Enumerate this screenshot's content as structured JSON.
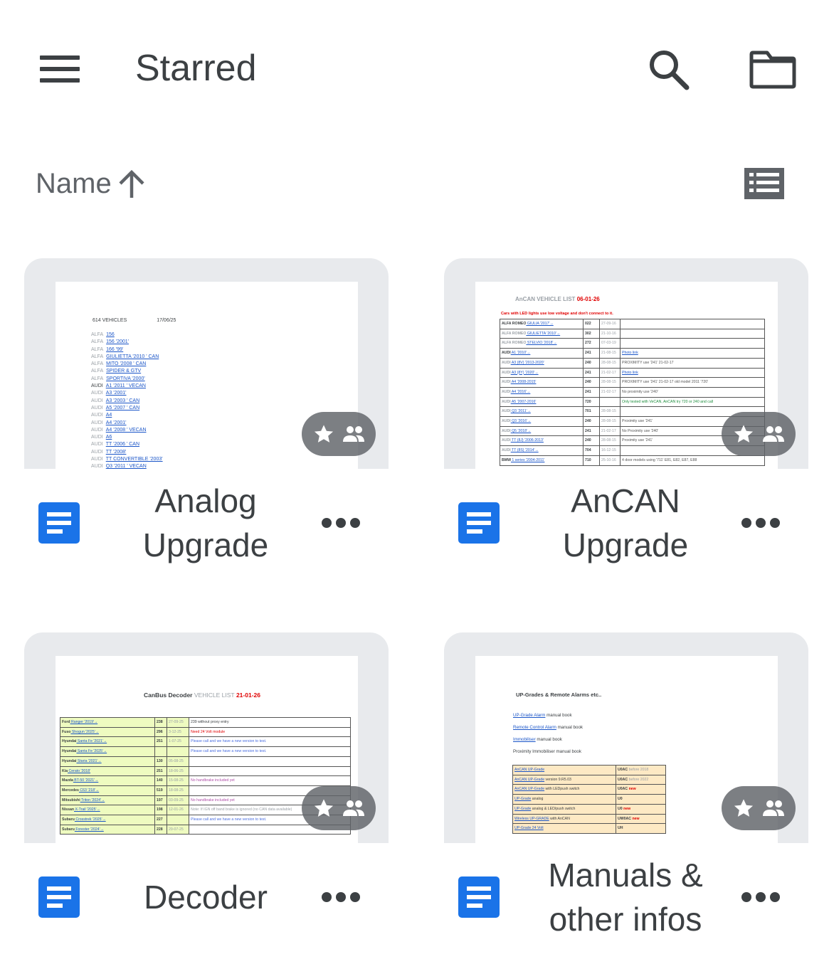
{
  "header": {
    "title": "Starred"
  },
  "sort": {
    "label": "Name",
    "arrow": "↑"
  },
  "files": [
    {
      "name": "Analog Upgrade",
      "preview": {
        "heading": "614 VEHICLES",
        "date": "17/06/25",
        "rows": [
          {
            "make": "ALFA",
            "model": "156"
          },
          {
            "make": "ALFA",
            "model": "156 '2001'"
          },
          {
            "make": "ALFA",
            "model": "166 '99'"
          },
          {
            "make": "ALFA",
            "model": "GIULIETTA '2010 ' CAN"
          },
          {
            "make": "ALFA",
            "model": "MITO '2008 ' CAN"
          },
          {
            "make": "ALFA",
            "model": "SPIDER & GTV"
          },
          {
            "make": "ALFA",
            "model": "SPORTIVA '2000'"
          },
          {
            "make": "AUDI",
            "model": "A1 '2011 ' VECAN"
          },
          {
            "make": "AUDI",
            "model": "A3 '2001'"
          },
          {
            "make": "AUDI",
            "model": "A3 '2003 ' CAN"
          },
          {
            "make": "AUDI",
            "model": "A5 '2007 ' CAN"
          },
          {
            "make": "AUDI",
            "model": "A4"
          },
          {
            "make": "AUDI",
            "model": "A4 '2001'"
          },
          {
            "make": "AUDI",
            "model": "A4 '2008 ' VECAN"
          },
          {
            "make": "AUDI",
            "model": "A6"
          },
          {
            "make": "AUDI",
            "model": "TT '2006 ' CAN"
          },
          {
            "make": "AUDI",
            "model": "TT '2008'"
          },
          {
            "make": "AUDI",
            "model": "TT CONVERTIBLE '2003'"
          },
          {
            "make": "AUDI",
            "model": "Q3 '2011 ' VECAN"
          }
        ]
      }
    },
    {
      "name": "AnCAN Upgrade",
      "preview": {
        "title": "AnCAN VEHICLE LIST",
        "date": "06-01-26",
        "warning": "Cars with LED lights use low voltage and don't connect to it.",
        "rows": [
          {
            "make": "ALFA ROMEO",
            "model": "GIULIA '2017'→",
            "code": "022",
            "date": "27-09-16",
            "note": ""
          },
          {
            "make": "ALFA ROMEO",
            "model": "GIULIETTA '2010'→",
            "code": "302",
            "date": "21-10-16",
            "note": ""
          },
          {
            "make": "ALFA ROMEO",
            "model": "STELVIO '2018'→",
            "code": "272",
            "date": "07-03-19",
            "note": ""
          },
          {
            "make": "AUDI",
            "model": "A1 '2010'→",
            "code": "241",
            "date": "21-08-15",
            "note": "Photo link"
          },
          {
            "make": "AUDI",
            "model": "A3 (8V) '2013-2020'",
            "code": "240",
            "date": "28-08-15",
            "note": "PROXIMITY use '241' 21-02-17"
          },
          {
            "make": "AUDI",
            "model": "A3 (8Y) '2020'→",
            "code": "241",
            "date": "21-02-17",
            "note": "Photo link"
          },
          {
            "make": "AUDI",
            "model": "A4 '2008-2015'",
            "code": "240",
            "date": "28-08-15",
            "note": "PROXIMITY use '241' 21-02-17 old model 2011 '720'"
          },
          {
            "make": "AUDI",
            "model": "A4 '2016'→",
            "code": "241",
            "date": "21-02-17",
            "note": "No proximity use '240'"
          },
          {
            "make": "AUDI",
            "model": "A5 '2007-2016'",
            "code": "720",
            "date": "",
            "note": "Only tested with VeCAN, AnCAN try 720 or 240 and call"
          },
          {
            "make": "AUDI",
            "model": "Q3 '2011'→",
            "code": "701",
            "date": "28-08-15",
            "note": ""
          },
          {
            "make": "AUDI",
            "model": "Q3 '2016'→",
            "code": "240",
            "date": "28-08-15",
            "note": "Proximity use '241'"
          },
          {
            "make": "AUDI",
            "model": "Q5 '2018'→",
            "code": "241",
            "date": "21-02-17",
            "note": "No Proximity use '240'"
          },
          {
            "make": "AUDI",
            "model": "TT (8J) '2006-2013'",
            "code": "240",
            "date": "28-08-15",
            "note": "Proximity use '241'"
          },
          {
            "make": "AUDI",
            "model": "TT (8S) '2014'→",
            "code": "704",
            "date": "16-12-15",
            "note": ""
          },
          {
            "make": "BMW",
            "model": "1 series '2004-2011'",
            "code": "710",
            "date": "25-10-16",
            "note": "4 door models using '711' E81, E82, E87, E88"
          }
        ]
      }
    },
    {
      "name": "Decoder",
      "preview": {
        "title_a": "CanBus Decoder",
        "title_b": "VEHICLE LIST",
        "date": "21-01-26",
        "rows": [
          {
            "make": "Ford",
            "model": "Ranger '2019'→",
            "code": "238",
            "date": "27-09-25",
            "note": "239 without proxy entry"
          },
          {
            "make": "Fuso",
            "model": "Shogun '2025'→",
            "code": "296",
            "date": "3-12-25",
            "note": "Need 24 Volt module"
          },
          {
            "make": "Hyundai",
            "model": "Santa Fe '2021'→",
            "code": "251",
            "date": "1-07-25",
            "note": "Please call and we have a new version to test."
          },
          {
            "make": "Hyundai",
            "model": "Santa Fe '2025'→",
            "code": "",
            "date": "",
            "note": "Please call and we have a new version to test."
          },
          {
            "make": "Hyundai",
            "model": "Staria '2021'→",
            "code": "130",
            "date": "05-08-25",
            "note": ""
          },
          {
            "make": "Kia",
            "model": "Cerato '2018'",
            "code": "251",
            "date": "18-06-25",
            "note": ""
          },
          {
            "make": "Mazda",
            "model": "BT-50 '2021'→",
            "code": "140",
            "date": "15-08-25",
            "note": "No handbrake included yet"
          },
          {
            "make": "Mercedes",
            "model": "C63 '218'→",
            "code": "519",
            "date": "18-08-25",
            "note": ""
          },
          {
            "make": "Mitsubishi",
            "model": "Triton '2024'→",
            "code": "197",
            "date": "03-09-25",
            "note": "No handbrake included yet"
          },
          {
            "make": "Nissan",
            "model": "X-Trail '2025'→",
            "code": "198",
            "date": "12-01-26",
            "note": "Note: If IGN off band brake is ignored (no CAN data available)"
          },
          {
            "make": "Subaru",
            "model": "Crosstrek '2025'→",
            "code": "227",
            "date": "",
            "note": "Please call and we have a new version to test."
          },
          {
            "make": "Subaru",
            "model": "Forester '2024'→",
            "code": "228",
            "date": "29-07-25",
            "note": ""
          }
        ]
      }
    },
    {
      "name": "Manuals & other infos",
      "preview": {
        "title": "UP-Grades & Remote Alarms etc..",
        "links": [
          {
            "link": "UP-Grade Alarm",
            "rest": " manual book"
          },
          {
            "link": "Remote Control Alarm",
            "rest": " manual book"
          },
          {
            "link": "Immobiliser",
            "rest": " manual book"
          },
          {
            "link": "",
            "rest": "Proximity Immobiliser manual book"
          }
        ],
        "rows": [
          {
            "item": "AnCAN UP-Grade",
            "extra": "",
            "code": "U0AC",
            "note": "before 2018"
          },
          {
            "item": "AnCAN UP-Grade",
            "extra": " version 9.R5.03",
            "code": "U0AC",
            "note": "before 2022"
          },
          {
            "item": "AnCAN UP-Grade",
            "extra": " with LEDpush switch",
            "code": "U0AC",
            "note": "new"
          },
          {
            "item": "UP-Grade",
            "extra": " analog",
            "code": "U0",
            "note": ""
          },
          {
            "item": "UP-Grade",
            "extra": " analog & LED/push switch",
            "code": "U0",
            "note": "new"
          },
          {
            "item": "Wireless UP-GRADE",
            "extra": " with AnCAN",
            "code": "UW0AC",
            "note": "new"
          },
          {
            "item": "UP-Grade 24 Volt",
            "extra": "",
            "code": "UH",
            "note": ""
          }
        ]
      }
    }
  ],
  "colors": {
    "doc_blue": "#1a73e8",
    "text": "#3c4043",
    "thumb_bg": "#e8eaed",
    "chip_bg": "#5f6368"
  },
  "icons": [
    "menu-icon",
    "search-icon",
    "folder-icon",
    "sort-arrow-icon",
    "list-view-icon",
    "star-icon",
    "shared-icon",
    "google-docs-icon",
    "more-icon"
  ]
}
